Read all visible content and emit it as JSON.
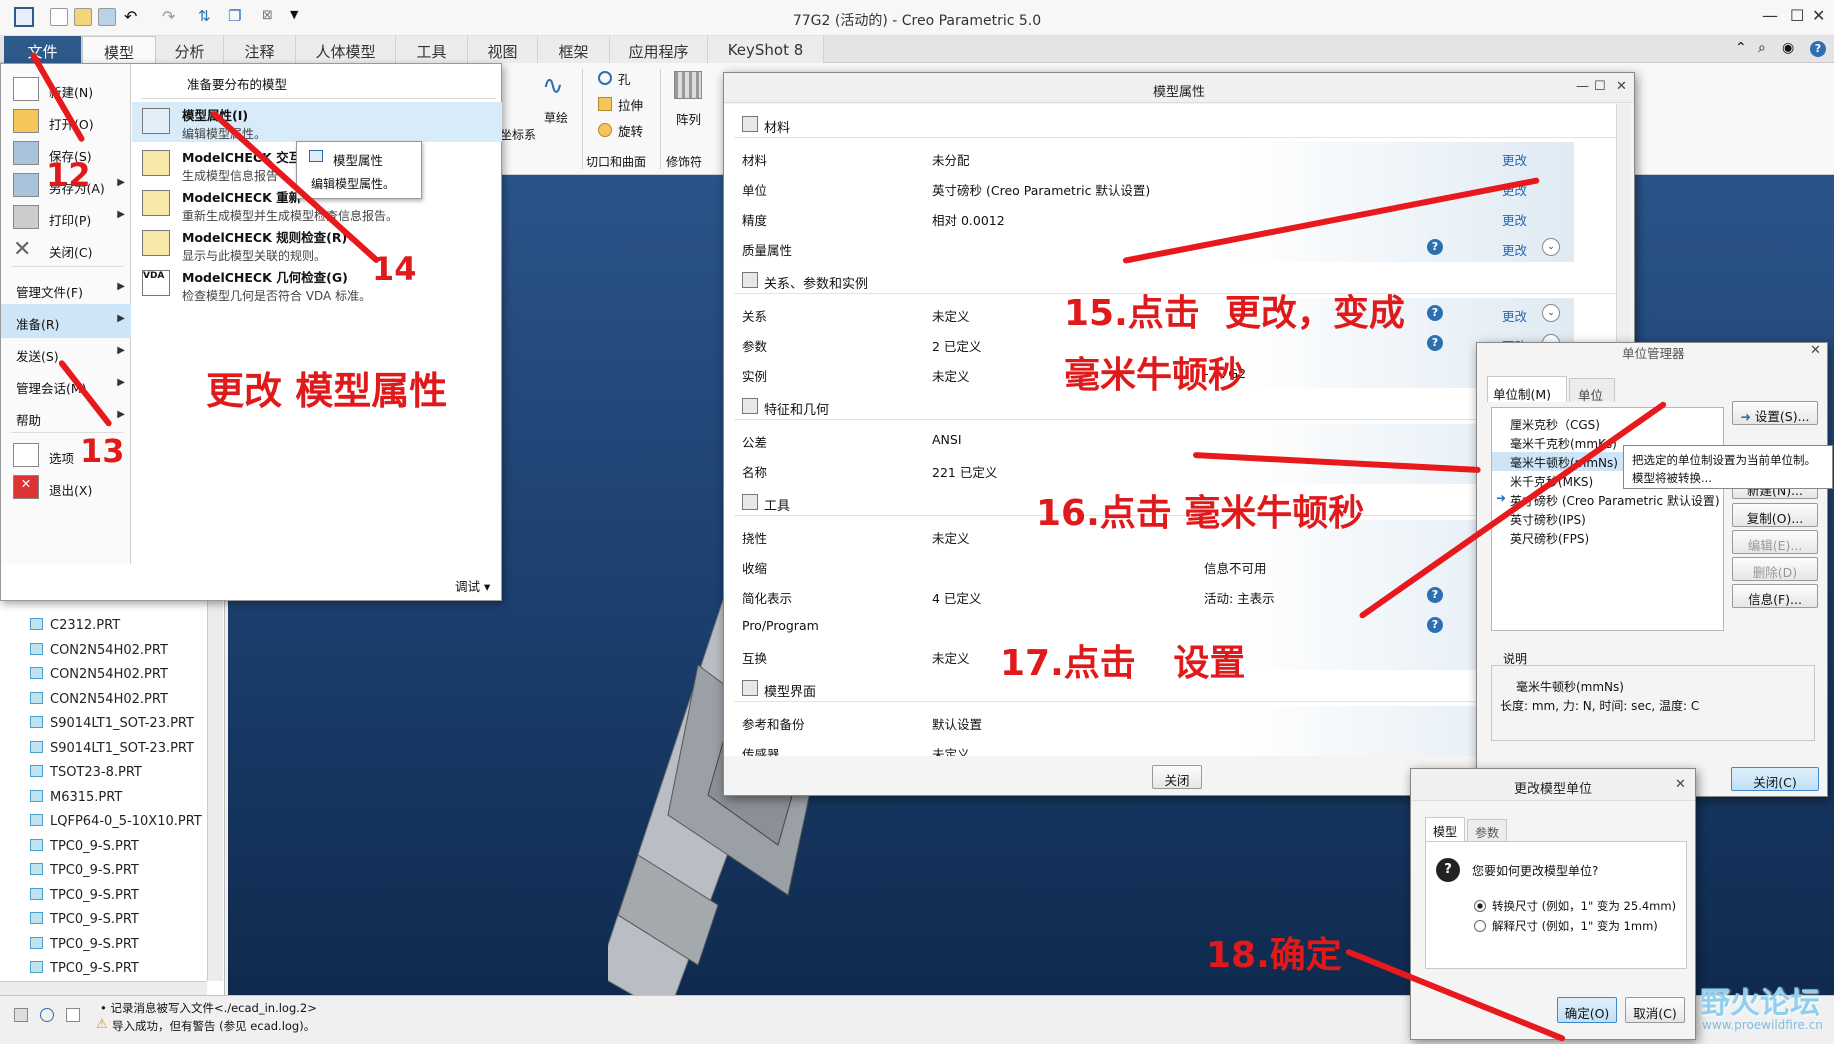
{
  "window": {
    "title": "77G2 (活动的) - Creo Parametric 5.0",
    "min": "—",
    "max": "☐",
    "close": "✕"
  },
  "tabs": [
    "文件",
    "模型",
    "分析",
    "注释",
    "人体模型",
    "工具",
    "视图",
    "框架",
    "应用程序",
    "KeyShot 8"
  ],
  "ribbon": {
    "groups": [
      {
        "items": [
          "孔",
          "拉伸",
          "旋转"
        ],
        "label": "切口和曲面"
      },
      {
        "items": [
          "阵列"
        ],
        "label": "修饰符"
      }
    ],
    "misc": [
      "草绘",
      "坐标系"
    ]
  },
  "file_menu": {
    "items": [
      {
        "label": "新建(N)",
        "arrow": false
      },
      {
        "label": "打开(O)",
        "arrow": false
      },
      {
        "label": "保存(S)",
        "arrow": false
      },
      {
        "label": "另存为(A)",
        "arrow": true
      },
      {
        "label": "打印(P)",
        "arrow": true
      },
      {
        "label": "关闭(C)",
        "arrow": false
      },
      {
        "label": "管理文件(F)",
        "arrow": true
      },
      {
        "label": "准备(R)",
        "arrow": true
      },
      {
        "label": "发送(S)",
        "arrow": true
      },
      {
        "label": "管理会话(M)",
        "arrow": true
      },
      {
        "label": "帮助",
        "arrow": true
      },
      {
        "label": "选项",
        "arrow": false
      },
      {
        "label": "退出(X)",
        "arrow": false
      }
    ],
    "sub_title": "准备要分布的模型",
    "sub_items": [
      {
        "title": "模型属性(I)",
        "desc": "编辑模型属性。"
      },
      {
        "title": "ModelCHECK 交互(",
        "desc": "生成模型信息报告"
      },
      {
        "title": "ModelCHECK 重新",
        "desc": "重新生成模型并生成模型检查信息报告。"
      },
      {
        "title": "ModelCHECK 规则检查(R)",
        "desc": "显示与此模型关联的规则。"
      },
      {
        "title": "ModelCHECK 几何检查(G)",
        "desc": "检查模型几何是否符合 VDA 标准。"
      }
    ],
    "tooltip_title": "模型属性",
    "tooltip_desc": "编辑模型属性。",
    "debug": "调试"
  },
  "model_tree": [
    "C2312.PRT",
    "CON2N54H02.PRT",
    "CON2N54H02.PRT",
    "CON2N54H02.PRT",
    "S9014LT1_SOT-23.PRT",
    "S9014LT1_SOT-23.PRT",
    "TSOT23-8.PRT",
    "M6315.PRT",
    "LQFP64-0_5-10X10.PRT",
    "TPC0_9-S.PRT",
    "TPC0_9-S.PRT",
    "TPC0_9-S.PRT",
    "TPC0_9-S.PRT",
    "TPC0_9-S.PRT",
    "TPC0_9-S.PRT"
  ],
  "status": {
    "line1": "• 记录消息被写入文件<./ecad_in.log.2>",
    "line2": "导入成功，但有警告 (参见 ecad.log)。"
  },
  "model_props": {
    "title": "模型属性",
    "close": "关闭",
    "sections": [
      {
        "name": "材料",
        "rows": [
          {
            "k": "材料",
            "v": "未分配",
            "v2": "",
            "action": "更改",
            "help": false,
            "expand": false
          },
          {
            "k": "单位",
            "v": "英寸磅秒 (Creo Parametric 默认设置)",
            "v2": "",
            "action": "更改",
            "help": false,
            "expand": false
          },
          {
            "k": "精度",
            "v": "相对 0.0012",
            "v2": "",
            "action": "更改",
            "help": false,
            "expand": false
          },
          {
            "k": "质量属性",
            "v": "",
            "v2": "",
            "action": "更改",
            "help": true,
            "expand": true
          }
        ]
      },
      {
        "name": "关系、参数和实例",
        "rows": [
          {
            "k": "关系",
            "v": "未定义",
            "v2": "",
            "action": "更改",
            "help": true,
            "expand": true
          },
          {
            "k": "参数",
            "v": "2 已定义",
            "v2": "",
            "action": "更改",
            "help": true,
            "expand": true
          },
          {
            "k": "实例",
            "v": "未定义",
            "v2": "- 77G2",
            "action": "",
            "help": false,
            "expand": false
          }
        ]
      },
      {
        "name": "特征和几何",
        "rows": [
          {
            "k": "公差",
            "v": "ANSI",
            "v2": "",
            "action": "",
            "help": false,
            "expand": false
          },
          {
            "k": "名称",
            "v": "221 已定义",
            "v2": "",
            "action": "",
            "help": false,
            "expand": false
          }
        ]
      },
      {
        "name": "工具",
        "rows": [
          {
            "k": "挠性",
            "v": "未定义",
            "v2": "",
            "action": "",
            "help": false,
            "expand": false
          },
          {
            "k": "收缩",
            "v": "",
            "v2": "信息不可用",
            "action": "",
            "help": false,
            "expand": false
          },
          {
            "k": "简化表示",
            "v": "4 已定义",
            "v2": "活动: 主表示",
            "action": "",
            "help": true,
            "expand": false
          },
          {
            "k": "Pro/Program",
            "v": "",
            "v2": "",
            "action": "",
            "help": true,
            "expand": false
          },
          {
            "k": "互换",
            "v": "未定义",
            "v2": "",
            "action": "",
            "help": false,
            "expand": false
          }
        ]
      },
      {
        "name": "模型界面",
        "rows": [
          {
            "k": "参考和备份",
            "v": "默认设置",
            "v2": "",
            "action": "",
            "help": false,
            "expand": false
          },
          {
            "k": "传感器",
            "v": "未定义",
            "v2": "",
            "action": "",
            "help": false,
            "expand": false
          }
        ]
      }
    ]
  },
  "units_mgr": {
    "title": "单位管理器",
    "tabs": [
      "单位制(M)",
      "单位"
    ],
    "list": [
      "厘米克秒（CGS)",
      "毫米千克秒(mmKs)",
      "毫米牛顿秒(mmNs)",
      "米千克秒(MKS)",
      "英寸磅秒 (Creo Parametric 默认设置)",
      "英寸磅秒(IPS)",
      "英尺磅秒(FPS)"
    ],
    "tooltip1": "把选定的单位制设置为当前单位制。",
    "tooltip2": "模型将被转换...",
    "buttons": [
      "设置(S)...",
      "新建(N)...",
      "复制(O)...",
      "编辑(E)...",
      "删除(D)",
      "信息(F)..."
    ],
    "desc_label": "说明",
    "desc_name": "毫米牛顿秒(mmNs)",
    "desc_text": "长度: mm, 力: N, 时间: sec, 温度: C",
    "close": "关闭(C)"
  },
  "change_units": {
    "title": "更改模型单位",
    "tabs": [
      "模型",
      "参数"
    ],
    "question": "您要如何更改模型单位?",
    "opt1": "转换尺寸 (例如，1\" 变为 25.4mm)",
    "opt2": "解释尺寸 (例如，1\" 变为 1mm)",
    "ok": "确定(O)",
    "cancel": "取消(C)"
  },
  "annotations": {
    "a12": "12",
    "a13": "13",
    "a14": "14",
    "change_props": "更改 模型属性",
    "a15a": "15.点击  更改，变成",
    "a15b": "毫米牛顿秒",
    "a16": "16.点击 毫米牛顿秒",
    "a17": "17.点击   设置",
    "a18": "18.确定"
  },
  "watermark": {
    "text": "野火论坛",
    "url": "www.proewildfire.cn"
  },
  "colors": {
    "annotation": "#e01a1a",
    "file_tab": "#2d5a8b",
    "link": "#2566b5",
    "selected": "#cde5f7"
  }
}
